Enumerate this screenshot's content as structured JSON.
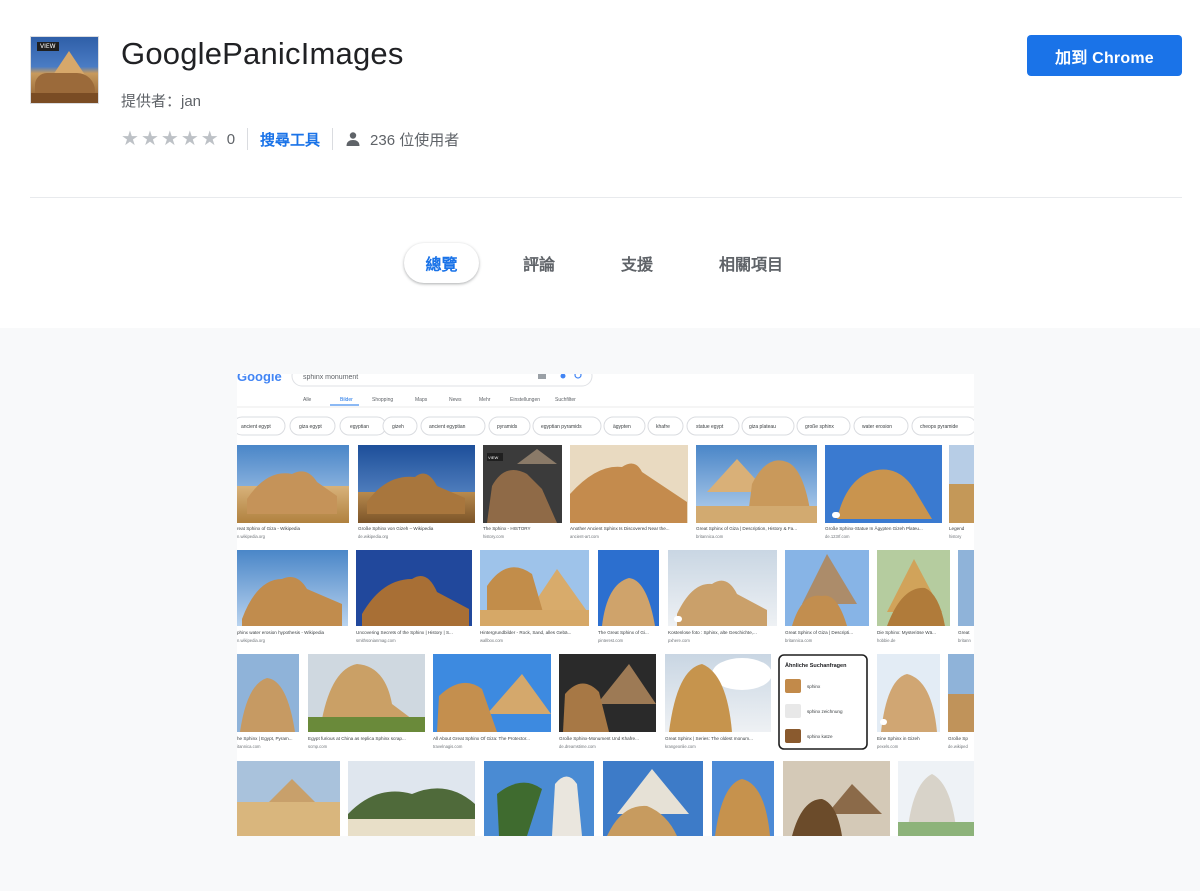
{
  "extension": {
    "icon_badge": "VIEW",
    "title": "GooglePanicImages",
    "provider_label": "提供者：jan",
    "rating": {
      "stars_filled": 0,
      "stars_total": 5,
      "count": "0"
    },
    "category": "搜尋工具",
    "users": "236 位使用者",
    "add_button": "加到 Chrome"
  },
  "tabs": [
    {
      "label": "總覽",
      "active": true
    },
    {
      "label": "評論",
      "active": false
    },
    {
      "label": "支援",
      "active": false
    },
    {
      "label": "相關項目",
      "active": false
    }
  ],
  "screenshot": {
    "logo": "Google",
    "query": "sphinx monument",
    "search_tabs": [
      "Alle",
      "Bilder",
      "Shopping",
      "Maps",
      "News",
      "Mehr",
      "Einstellungen",
      "Suchfilter"
    ],
    "chips": [
      "ancient egypt",
      "giza egypt",
      "egyptian",
      "gizeh",
      "ancient egyptian",
      "pyramids",
      "egyptian pyramids",
      "ägypten",
      "khafre",
      "statue egypt",
      "giza plateau",
      "große sphinx",
      "water erosion",
      "cheops pyramide"
    ],
    "row1": [
      {
        "caption": "reat Sphinx of Giza - Wikipedia",
        "source": "n.wikipedia.org"
      },
      {
        "caption": "Große Sphinx von Gizeh – Wikipedia",
        "source": "de.wikipedia.org"
      },
      {
        "caption": "The Sphinx - HISTORY",
        "source": "history.com"
      },
      {
        "caption": "Another Ancient Sphinx Is Discovered Near the...",
        "source": "ancient-art.com"
      },
      {
        "caption": "Great Sphinx of Giza | Description, History & Fa...",
        "source": "britannica.com"
      },
      {
        "caption": "Große Sphinx-Statue In Ägypten Gizeh Plateu...",
        "source": "de.123rf.com"
      },
      {
        "caption": "Legend",
        "source": "history"
      }
    ],
    "row2": [
      {
        "caption": "phinx water erosion hypothesis - Wikipedia",
        "source": "n.wikipedia.org"
      },
      {
        "caption": "Uncovering Secrets of the Sphinx | History | S...",
        "source": "smithsonianmag.com"
      },
      {
        "caption": "Hintergrundbilder - Rock, Sand, alles Gebä...",
        "source": "wallbox.com"
      },
      {
        "caption": "The Great Sphinx of Gi...",
        "source": "pinterest.com"
      },
      {
        "caption": "Kostenlose foto : Sphinx, alte Geschichte,...",
        "source": "pxhere.com"
      },
      {
        "caption": "Great Sphinx of Giza | Descripti...",
        "source": "britannica.com"
      },
      {
        "caption": "Die Sphinx: Mysteriöse Wä...",
        "source": "hobbie.de"
      },
      {
        "caption": "Great",
        "source": "britann"
      }
    ],
    "row3": [
      {
        "caption": "he Sphinx | Egypt, Pyram...",
        "source": "itannica.com"
      },
      {
        "caption": "Egypt furious at China as replica Sphinx scrap...",
        "source": "scmp.com"
      },
      {
        "caption": "All About Great Sphinx Of Giza: The Protector...",
        "source": "travelnagis.com"
      },
      {
        "caption": "Große Sphinx-Monument Und Khafre...",
        "source": "de.dreamstime.com"
      },
      {
        "caption": "Great Sphinx | Series: The oldest monum...",
        "source": "krangeonlie.com"
      },
      {
        "caption": "Eine Sphinx in Gizeh",
        "source": "pexels.com"
      },
      {
        "caption": "Große Sp",
        "source": "de.wikiped"
      }
    ],
    "related": {
      "title": "Ähnliche Suchanfragen",
      "items": [
        "sphinx",
        "sphinx zeichnung",
        "sphinx katze"
      ]
    }
  },
  "colors": {
    "accent": "#1a73e8",
    "star_empty": "#bdc1c6",
    "gallery_bg": "#f8f9fa"
  }
}
